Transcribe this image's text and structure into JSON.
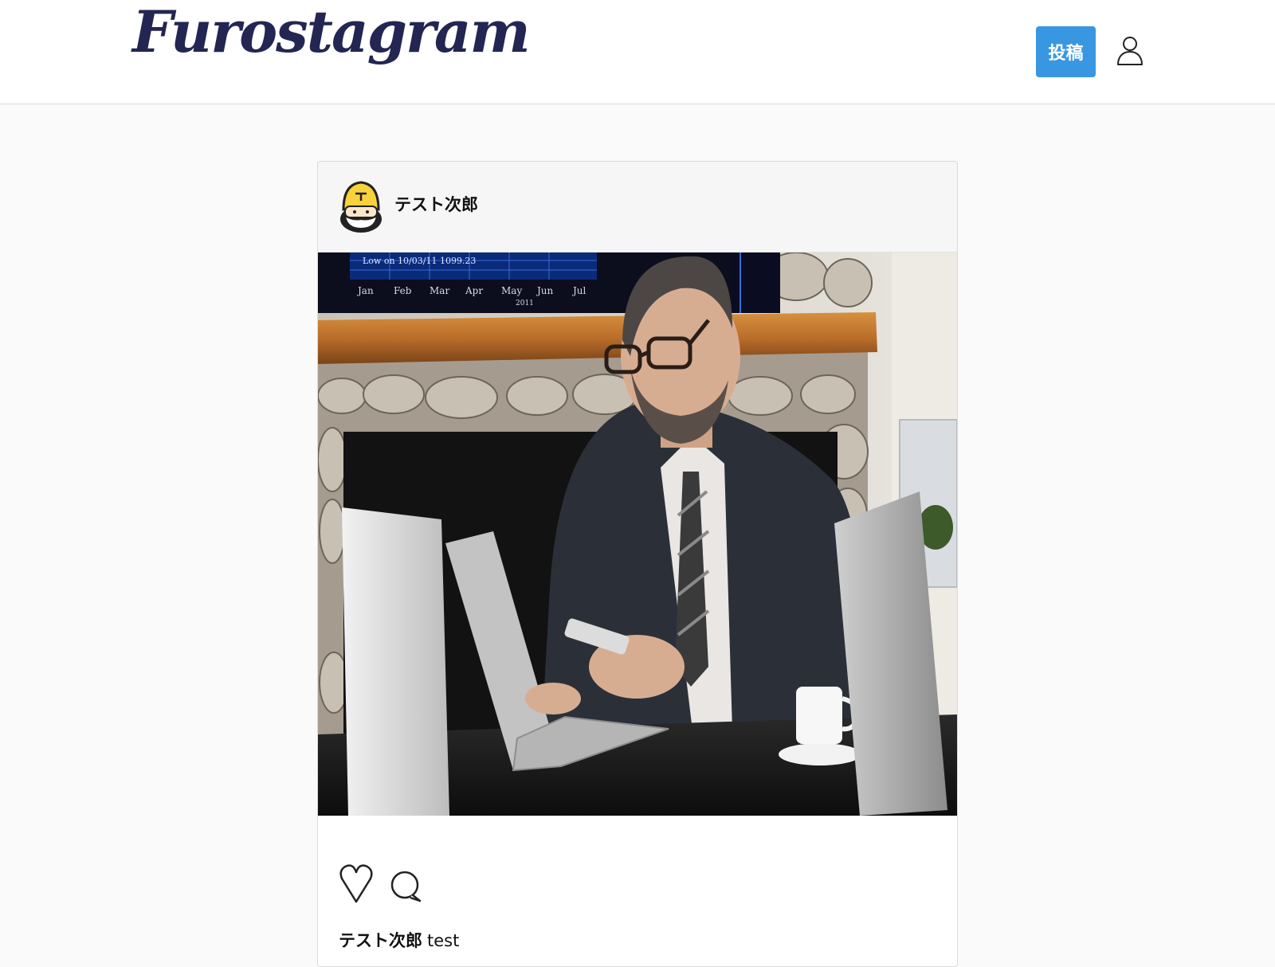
{
  "header": {
    "logo_text": "Furostagram",
    "post_button_label": "投稿",
    "profile_icon": "user-icon"
  },
  "post": {
    "username": "テスト次郎",
    "avatar_icon": "gnome-avatar-icon",
    "image_alt": "businessman-at-laptop-photo",
    "chart_screen": {
      "label": "Low on 10/03/11  1099.23",
      "months": [
        "Jan",
        "Feb",
        "Mar",
        "Apr",
        "May",
        "Jun",
        "Jul"
      ],
      "year": "2011"
    },
    "like_icon": "heart-icon",
    "comment_icon": "comment-icon",
    "caption_user": "テスト次郎",
    "caption_text": "test"
  },
  "colors": {
    "logo": "#232652",
    "post_button": "#3897e0",
    "page_background": "#fafafa",
    "card_header": "#f6f6f6"
  }
}
